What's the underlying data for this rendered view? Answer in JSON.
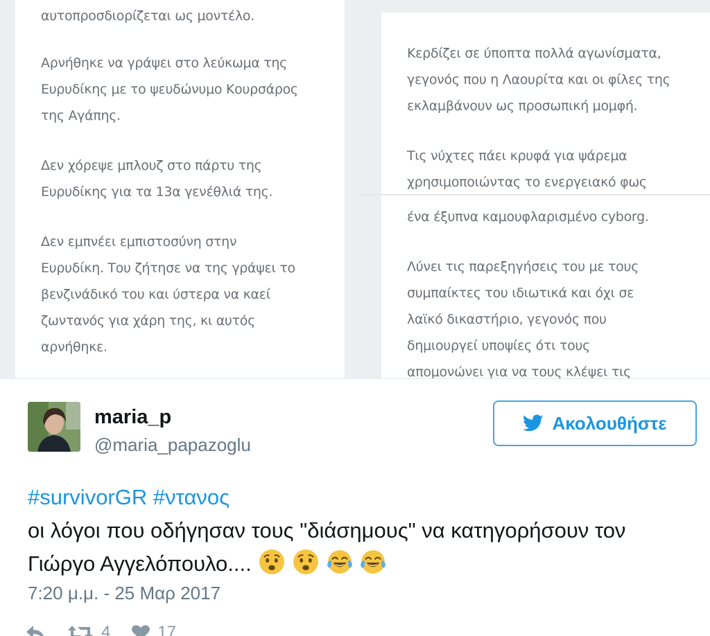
{
  "embedded_screenshot": {
    "left_column": [
      "αυτοπροσδιορίζεται ως μοντέλο.",
      "Αρνήθηκε να γράψει στο λεύκωμα της\nΕυρυδίκης με το ψευδώνυμο Κουρσάρος\nτης Αγάπης.",
      "Δεν χόρεψε μπλουζ στο πάρτυ της\nΕυρυδίκης για τα 13α γενέθλιά της.",
      "Δεν εμπνέει εμπιστοσύνη στην\nΕυρυδίκη. Του ζήτησε να της γράψει το\nβενζινάδικό του και ύστερα να καεί\nζωντανός για χάρη της, κι αυτός\nαρνήθηκε."
    ],
    "right_column_top": [
      "Κερδίζει σε ύποπτα πολλά αγωνίσματα,\nγεγονός που η Λαουρίτα και οι φίλες της\nεκλαμβάνουν ως προσωπική μομφή.",
      "Τις νύχτες πάει κρυφά για ψάρεμα\nχρησιμοποιώντας το ενεργειακό φως"
    ],
    "right_column_bottom": [
      "ένα έξυπνα καμουφλαρισμένο cyborg.",
      "Λύνει τις παρεξηγήσεις του με τους\nσυμπαίκτες του ιδιωτικά και όχι σε\nλαϊκό δικαστήριο, γεγονός που\nδημιουργεί υποψίες ότι τους\nαπομονώνει για να τους κλέψει τις"
    ]
  },
  "tweet": {
    "display_name": "maria_p",
    "username": "@maria_papazoglu",
    "follow_label": "Ακολουθήστε",
    "hashtag_1": "#survivorGR",
    "hashtag_2": "#ντανος",
    "text_line_1": "οι λόγοι που οδήγησαν τους \"διάσημους\" να κατηγορήσουν τον",
    "text_line_2": "Γιώργο Αγγελόπουλο....",
    "emojis": [
      "worried-face",
      "worried-face",
      "tears-of-joy",
      "tears-of-joy"
    ],
    "timestamp": "7:20 μ.μ. - 25 Μαρ 2017",
    "retweet_count": "4",
    "like_count": "17"
  },
  "colors": {
    "link_blue": "#1b95e0",
    "follow_border": "#4aa3de",
    "text_dark": "#14171a",
    "text_muted": "#657786",
    "panel_bg": "#eceef1"
  }
}
